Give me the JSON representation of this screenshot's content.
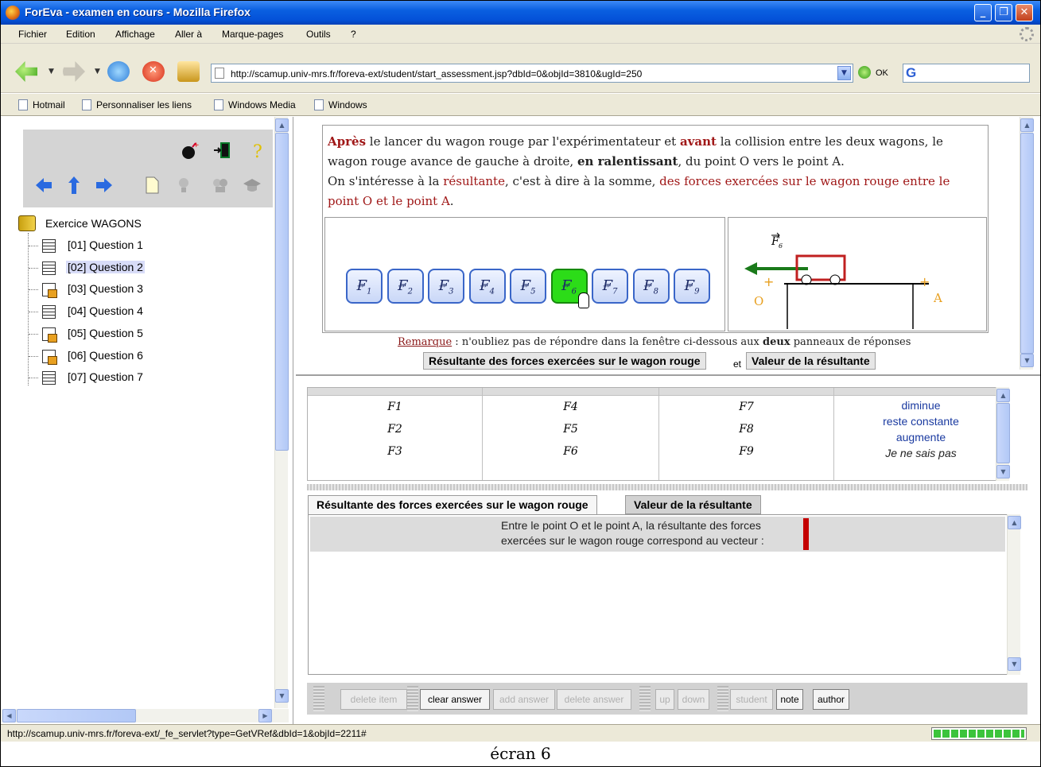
{
  "window": {
    "title": "ForEva - examen en cours - Mozilla Firefox"
  },
  "menu": {
    "items": [
      "Fichier",
      "Edition",
      "Affichage",
      "Aller à",
      "Marque-pages",
      "Outils",
      "?"
    ]
  },
  "nav": {
    "url": "http://scamup.univ-mrs.fr/foreva-ext/student/start_assessment.jsp?dbId=0&objId=3810&ugId=250",
    "go_label": "OK"
  },
  "bookmarks": [
    "Hotmail",
    "Personnaliser les liens",
    "Windows Media",
    "Windows"
  ],
  "tree": {
    "root": "Exercice WAGONS",
    "items": [
      {
        "label": "[01] Question 1",
        "icon": "question-icon"
      },
      {
        "label": "[02] Question 2",
        "icon": "question-icon",
        "selected": true
      },
      {
        "label": "[03] Question 3",
        "icon": "locked-question-icon"
      },
      {
        "label": "[04] Question 4",
        "icon": "question-icon"
      },
      {
        "label": "[05] Question 5",
        "icon": "locked-question-icon"
      },
      {
        "label": "[06] Question 6",
        "icon": "locked-question-icon"
      },
      {
        "label": "[07] Question 7",
        "icon": "question-icon"
      }
    ]
  },
  "question": {
    "p1_w1": "Après",
    "p1_t1": " le lancer du wagon rouge par l'expérimentateur et ",
    "p1_w2": "avant",
    "p1_t2": " la collision entre les deux wagons, le wagon rouge avance de gauche à droite, ",
    "p1_w3": "en ralentissant",
    "p1_t3": ", du point O vers le point A.",
    "p2_t1": "On s'intéresse à la ",
    "p2_w1": "résultante",
    "p2_t2": ", c'est à dire à la somme, ",
    "p2_w2": "des forces exercées sur le wagon rouge entre le point O et le point A",
    "p2_t3": ".",
    "forces": [
      {
        "letter": "F",
        "index": "1"
      },
      {
        "letter": "F",
        "index": "2"
      },
      {
        "letter": "F",
        "index": "3"
      },
      {
        "letter": "F",
        "index": "4"
      },
      {
        "letter": "F",
        "index": "5"
      },
      {
        "letter": "F",
        "index": "6",
        "active": true
      },
      {
        "letter": "F",
        "index": "7"
      },
      {
        "letter": "F",
        "index": "8"
      },
      {
        "letter": "F",
        "index": "9"
      }
    ],
    "diagram": {
      "force_label": "F",
      "force_index": "6",
      "point_o": "O",
      "point_a": "A"
    },
    "note_label": "Remarque",
    "note_t1": " : n'oubliez pas de répondre dans la fenêtre ci-dessous aux ",
    "note_bold": "deux",
    "note_t2": " panneaux de réponses",
    "tab1": "Résultante des forces exercées sur le wagon rouge",
    "tab_et": "et",
    "tab2": "Valeur de la résultante"
  },
  "answers": {
    "col1": [
      "F1",
      "F2",
      "F3"
    ],
    "col2": [
      "F4",
      "F5",
      "F6"
    ],
    "col3": [
      "F7",
      "F8",
      "F9"
    ],
    "col4": [
      "diminue",
      "reste constante",
      "augmente",
      "Je ne sais pas"
    ],
    "tab_active": "Résultante des forces exercées sur le wagon rouge",
    "tab_inactive": "Valeur de la résultante",
    "prompt_line1": "Entre le point O et le point A, la résultante des forces",
    "prompt_line2": "exercées sur le wagon rouge correspond au vecteur :",
    "buttons": [
      {
        "label": "delete item",
        "enabled": false
      },
      {
        "label": "clear answer",
        "enabled": true
      },
      {
        "label": "add answer",
        "enabled": false
      },
      {
        "label": "delete answer",
        "enabled": false
      },
      {
        "label": "up",
        "enabled": false
      },
      {
        "label": "down",
        "enabled": false
      },
      {
        "label": "student",
        "enabled": false
      },
      {
        "label": "note",
        "enabled": true
      },
      {
        "label": "author",
        "enabled": true
      }
    ]
  },
  "status": {
    "text": "http://scamup.univ-mrs.fr/foreva-ext/_fe_servlet?type=GetVRef&dbId=1&objId=2211#",
    "progress": 1.0
  },
  "caption": "écran 6",
  "colors": {
    "titlebar": "#0451d8",
    "accent_red": "#a01818",
    "active_force": "#2cdc18",
    "chrome": "#ece9d8"
  }
}
